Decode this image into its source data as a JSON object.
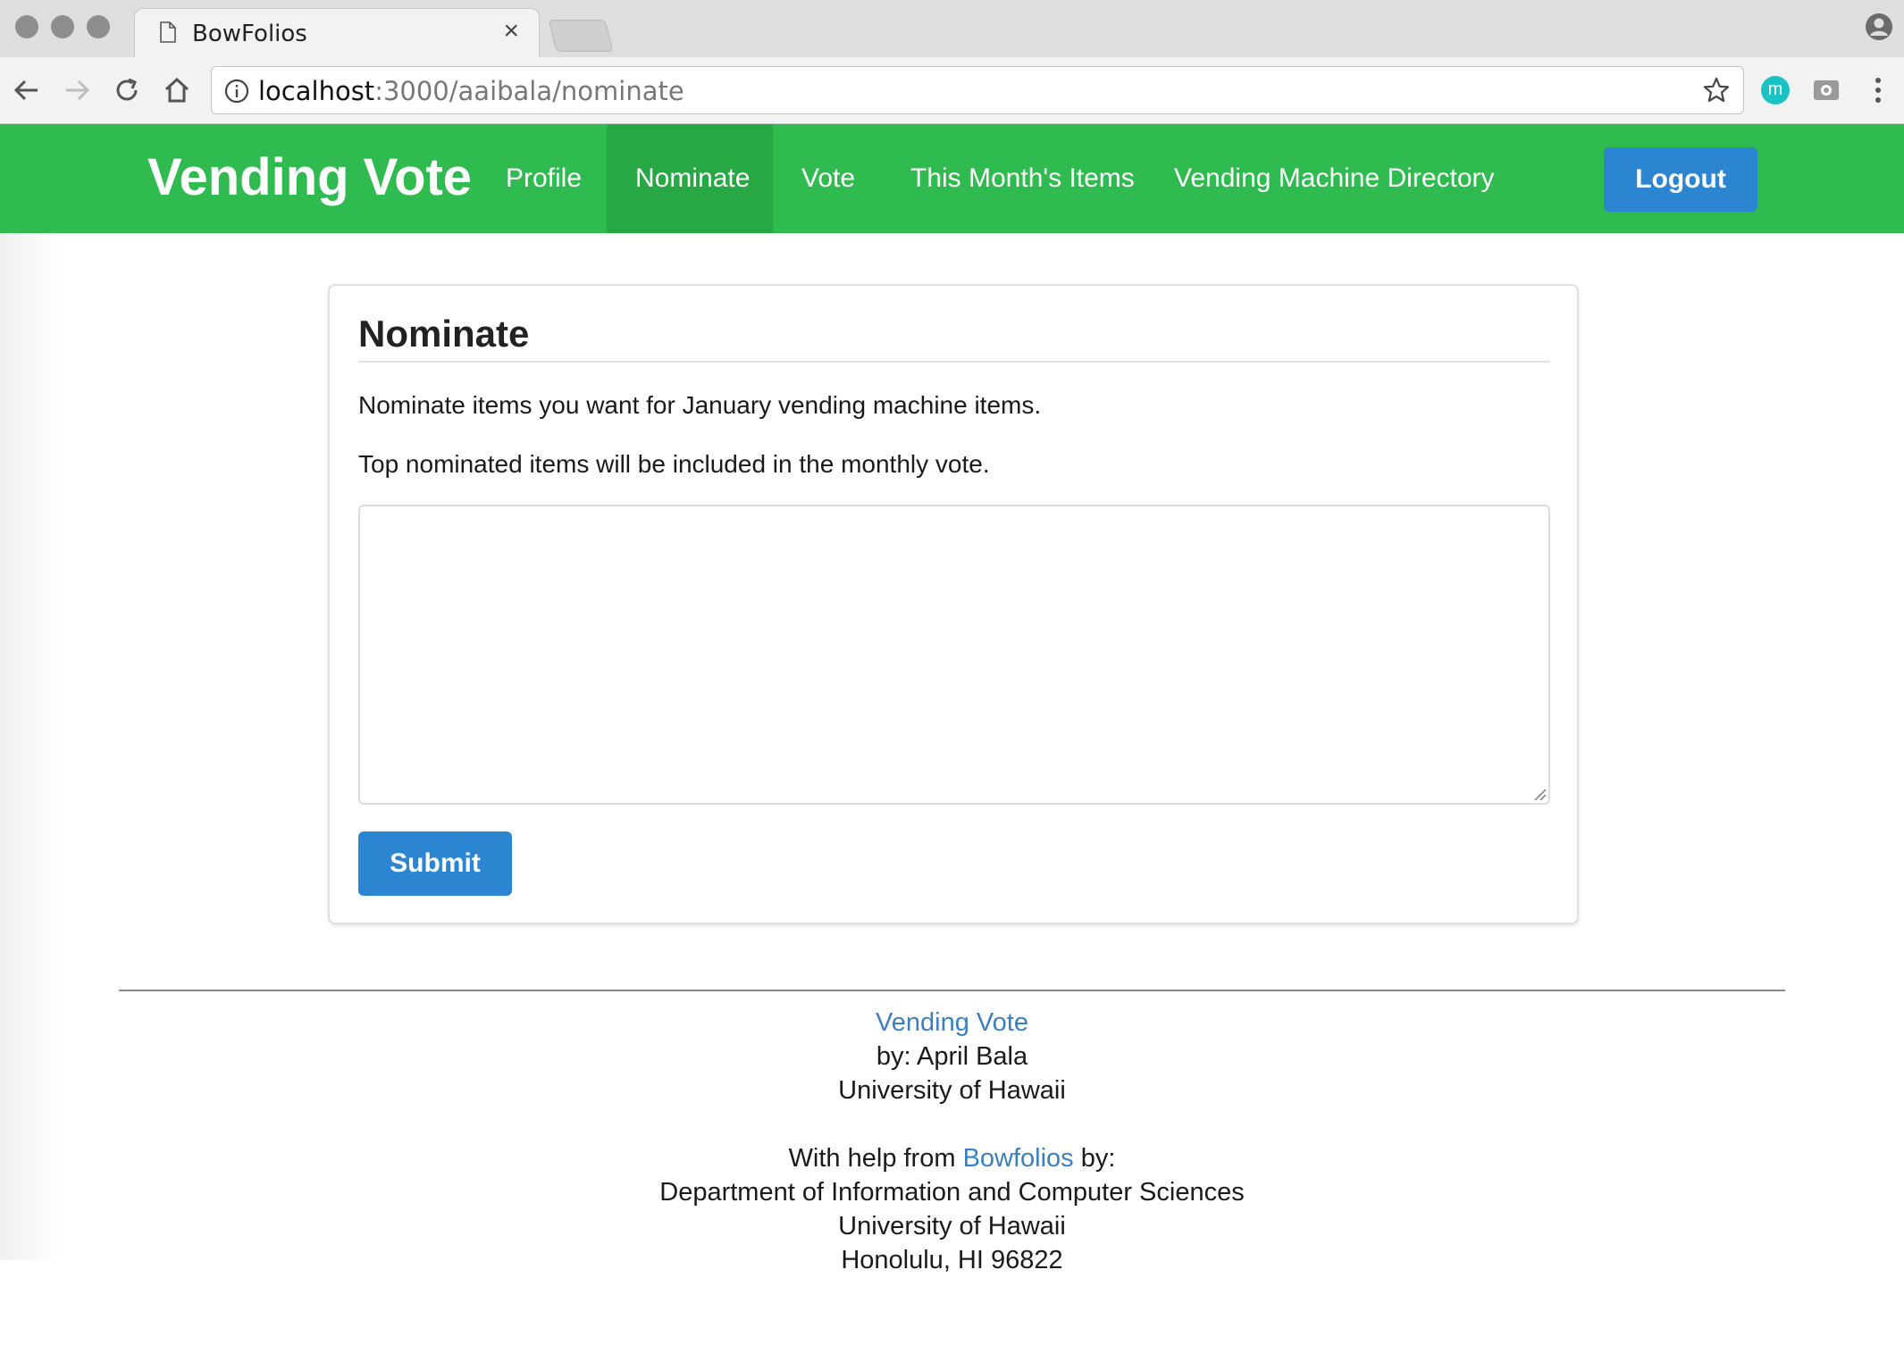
{
  "browser": {
    "tab_title": "BowFolios",
    "tab_close": "×",
    "url_host": "localhost",
    "url_path": ":3000/aaibala/nominate",
    "extension_letter": "m"
  },
  "navbar": {
    "brand": "Vending Vote",
    "items": [
      {
        "label": "Profile",
        "active": false
      },
      {
        "label": "Nominate",
        "active": true
      },
      {
        "label": "Vote",
        "active": false
      },
      {
        "label": "This Month's Items",
        "active": false
      },
      {
        "label": "Vending Machine Directory",
        "active": false
      }
    ],
    "logout_label": "Logout",
    "colors": {
      "bar": "#2fbb4f",
      "active": "#28a745",
      "button": "#2b85d1"
    }
  },
  "nominate": {
    "title": "Nominate",
    "line1": "Nominate items you want for January vending machine items.",
    "line2": "Top nominated items will be included in the monthly vote.",
    "textarea_value": "",
    "submit_label": "Submit"
  },
  "footer": {
    "app_link": "Vending Vote",
    "author": "by: April Bala",
    "university": "University of Hawaii",
    "help_prefix": "With help from ",
    "help_link": "Bowfolios",
    "help_suffix": " by:",
    "department": "Department of Information and Computer Sciences",
    "university2": "University of Hawaii",
    "address": "Honolulu, HI 96822"
  }
}
